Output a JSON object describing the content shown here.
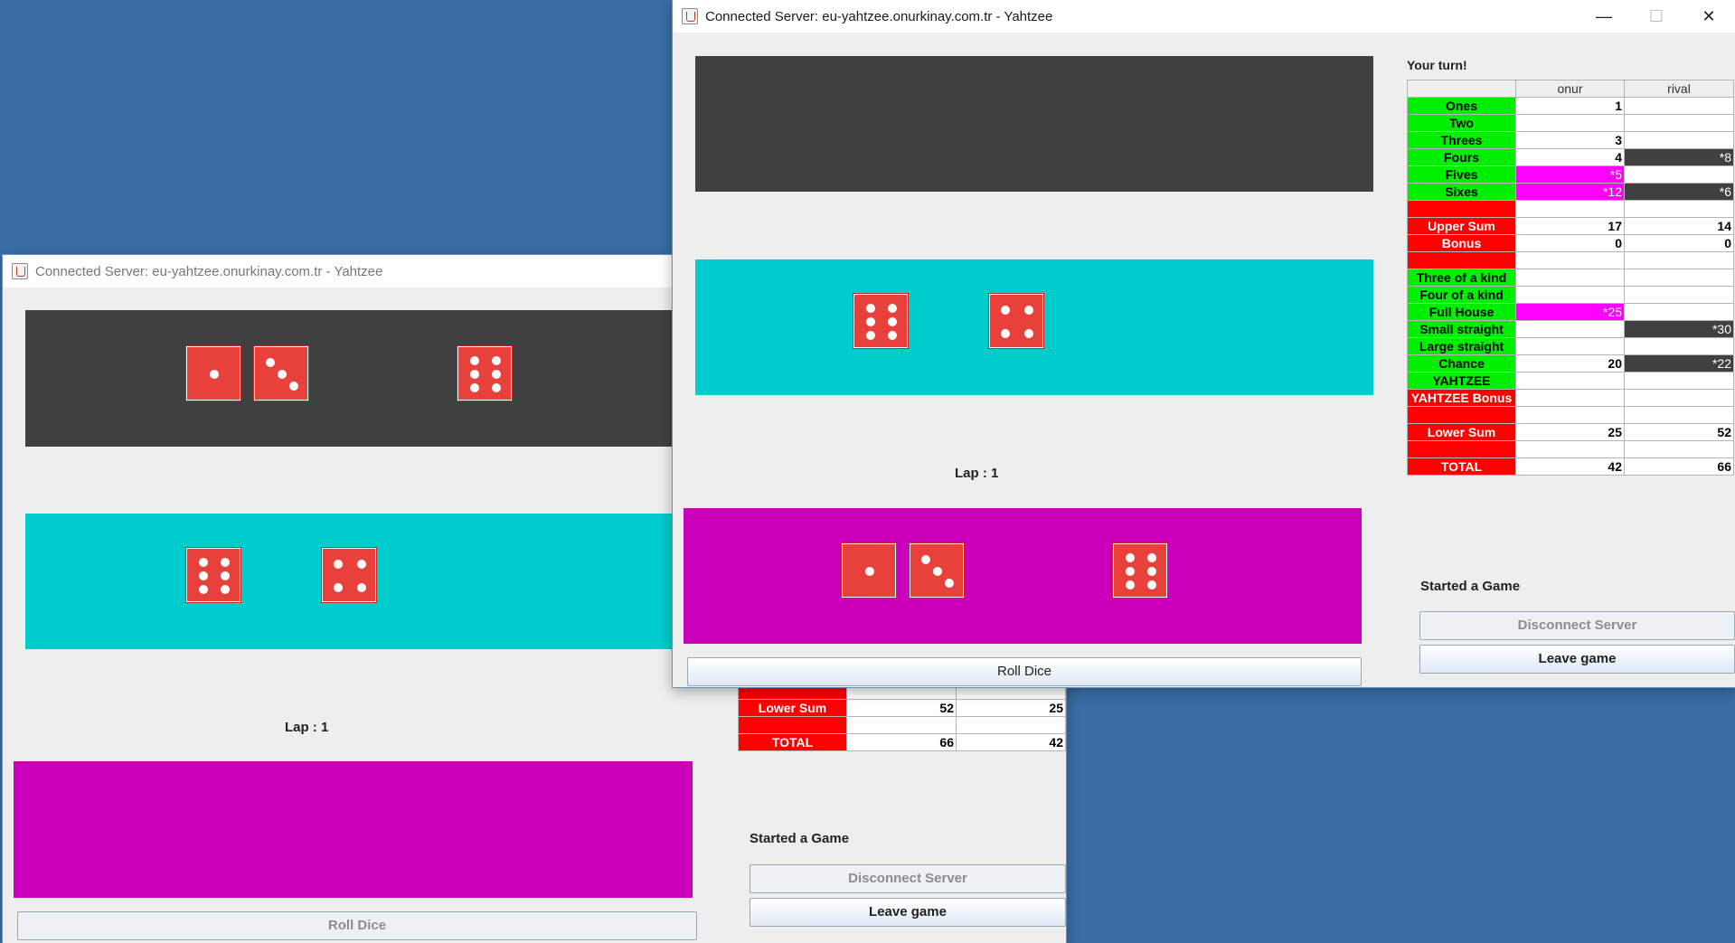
{
  "desktop": {
    "background": "#3a6ea5"
  },
  "back_window": {
    "title": "Connected Server: eu-yahtzee.onurkinay.com.tr - Yahtzee",
    "lap_text": "Lap : 1",
    "roll_dice_label": "Roll Dice",
    "status_text": "Started a Game",
    "disconnect_label": "Disconnect Server",
    "leave_label": "Leave game",
    "top_dice": [
      1,
      3,
      6
    ],
    "middle_dice": [
      6,
      4
    ],
    "score_rows": [
      {
        "label": "Lower Sum",
        "p1": "52",
        "p2": "25"
      },
      {
        "label": "",
        "p1": "",
        "p2": ""
      },
      {
        "label": "TOTAL",
        "p1": "66",
        "p2": "42"
      }
    ]
  },
  "front_window": {
    "title": "Connected Server: eu-yahtzee.onurkinay.com.tr - Yahtzee",
    "turn_text": "Your turn!",
    "lap_text": "Lap : 1",
    "roll_dice_label": "Roll Dice",
    "status_text": "Started a Game",
    "disconnect_label": "Disconnect Server",
    "leave_label": "Leave game",
    "middle_dice": [
      6,
      4
    ],
    "bottom_dice": [
      1,
      3,
      6
    ],
    "controls": {
      "minimize": "—",
      "maximize": "☐",
      "close": "✕"
    },
    "players": [
      "onur",
      "rival"
    ],
    "score_rows": [
      {
        "label": "Ones",
        "color": "green",
        "p1": "1",
        "p2": ""
      },
      {
        "label": "Two",
        "color": "green",
        "p1": "",
        "p2": ""
      },
      {
        "label": "Threes",
        "color": "green",
        "p1": "3",
        "p2": ""
      },
      {
        "label": "Fours",
        "color": "green",
        "p1": "4",
        "p2": "*8",
        "p2_style": "dark"
      },
      {
        "label": "Fives",
        "color": "green",
        "p1": "*5",
        "p1_style": "mag",
        "p2": ""
      },
      {
        "label": "Sixes",
        "color": "green",
        "p1": "*12",
        "p1_style": "mag",
        "p2": "*6",
        "p2_style": "dark"
      },
      {
        "label": "",
        "color": "red",
        "p1": "",
        "p2": ""
      },
      {
        "label": "Upper Sum",
        "color": "red",
        "p1": "17",
        "p2": "14"
      },
      {
        "label": "Bonus",
        "color": "red",
        "p1": "0",
        "p2": "0"
      },
      {
        "label": "",
        "color": "red",
        "p1": "",
        "p2": ""
      },
      {
        "label": "Three of a kind",
        "color": "green",
        "p1": "",
        "p2": ""
      },
      {
        "label": "Four of a kind",
        "color": "green",
        "p1": "",
        "p2": ""
      },
      {
        "label": "Full House",
        "color": "green",
        "p1": "*25",
        "p1_style": "mag",
        "p2": ""
      },
      {
        "label": "Small straight",
        "color": "green",
        "p1": "",
        "p2": "*30",
        "p2_style": "dark"
      },
      {
        "label": "Large straight",
        "color": "green",
        "p1": "",
        "p2": ""
      },
      {
        "label": "Chance",
        "color": "green",
        "p1": "20",
        "p2": "*22",
        "p2_style": "dark"
      },
      {
        "label": "YAHTZEE",
        "color": "green",
        "p1": "",
        "p2": ""
      },
      {
        "label": "YAHTZEE Bonus",
        "color": "red",
        "p1": "",
        "p2": ""
      },
      {
        "label": "",
        "color": "red",
        "p1": "",
        "p2": ""
      },
      {
        "label": "Lower Sum",
        "color": "red",
        "p1": "25",
        "p2": "52"
      },
      {
        "label": "",
        "color": "red",
        "p1": "",
        "p2": ""
      },
      {
        "label": "TOTAL",
        "color": "red",
        "p1": "42",
        "p2": "66"
      }
    ]
  }
}
